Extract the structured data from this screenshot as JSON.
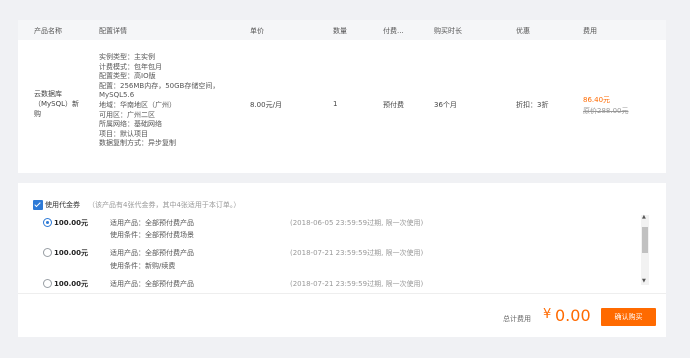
{
  "table": {
    "headers": [
      "产品名称",
      "配置详情",
      "单价",
      "数量",
      "付费...",
      "购买时长",
      "优惠",
      "费用"
    ],
    "row": {
      "product": [
        "云数据库",
        "（MySQL）新",
        "购"
      ],
      "config": [
        "实例类型：主实例",
        "计费模式：包年包月",
        "配置类型：高IO版",
        "配置：256MB内存，50GB存储空间，",
        "MySQL5.6",
        "地域：华南地区（广州）",
        "可用区：广州二区",
        "所属网络：基础网络",
        "项目：默认项目",
        "数据复制方式：异步复制"
      ],
      "unit_price": "8.00元/月",
      "quantity": "1",
      "pay_type": "预付费",
      "duration": "36个月",
      "discount": "折扣：3折",
      "fee": "86.40元",
      "original_fee": "原价288.00元"
    }
  },
  "coupon": {
    "use_label": "使用代金券",
    "hint": "（该产品有4张代金券，其中4张适用于本订单。）",
    "checked": true,
    "items": [
      {
        "amount": "100.00元",
        "product": "适用产品：全部预付费产品",
        "condition": "使用条件：全部预付费场景",
        "expire": "(2018-06-05 23:59:59过期, 限一次使用)",
        "selected": true
      },
      {
        "amount": "100.00元",
        "product": "适用产品：全部预付费产品",
        "condition": "使用条件：新购/续费",
        "expire": "(2018-07-21 23:59:59过期, 限一次使用)",
        "selected": false
      },
      {
        "amount": "100.00元",
        "product": "适用产品：全部预付费产品",
        "condition": "",
        "expire": "(2018-07-21 23:59:59过期, 限一次使用)",
        "selected": false
      }
    ],
    "scroll_up": "▲",
    "scroll_down": "▼"
  },
  "footer": {
    "total_label": "总计费用",
    "currency": "¥",
    "total": "0.00",
    "confirm_label": "确认购买"
  },
  "colors": {
    "accent": "#ff6a00",
    "check": "#2e7ad6"
  }
}
